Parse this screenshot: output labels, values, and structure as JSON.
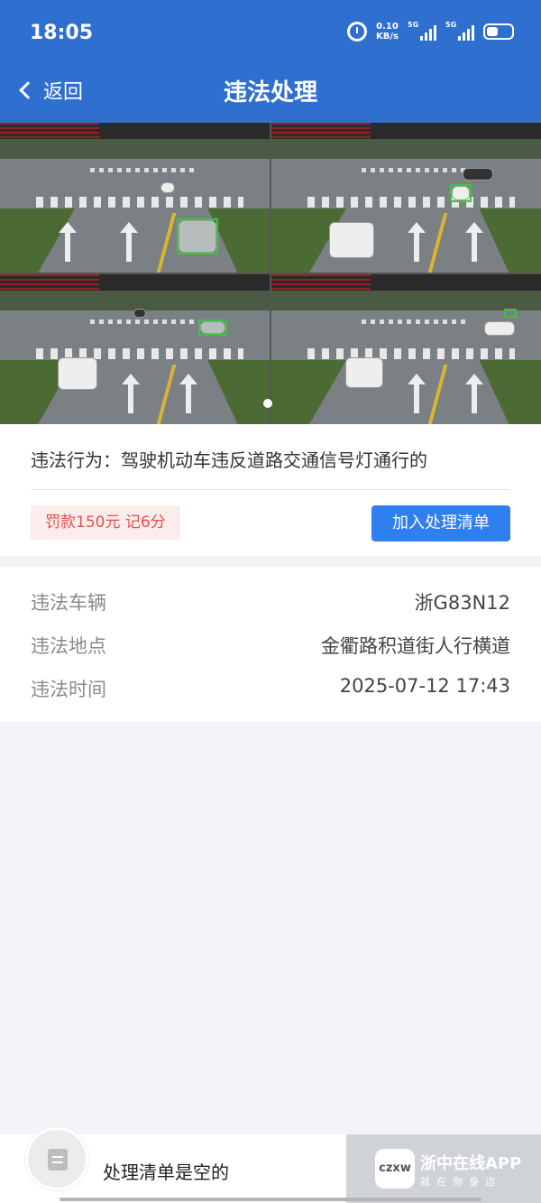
{
  "status_bar": {
    "time": "18:05",
    "speed_value": "0.10",
    "speed_unit": "KB/s",
    "sim1_tag": "5G",
    "sim2_tag": "5G"
  },
  "header": {
    "back_label": "返回",
    "title": "违法处理",
    "background": "#2f6fcf"
  },
  "photos": {
    "count": 4,
    "pager_dots": 1
  },
  "violation": {
    "behavior_label": "违法行为：",
    "behavior_text": "驾驶机动车违反道路交通信号灯通行的",
    "fine_text": "罚款150元 记6分",
    "add_button": "加入处理清单"
  },
  "details": [
    {
      "label": "违法车辆",
      "value": "浙G83N12"
    },
    {
      "label": "违法地点",
      "value": "金衢路积道街人行横道"
    },
    {
      "label": "违法时间",
      "value": "2025-07-12 17:43"
    }
  ],
  "bottom": {
    "empty_text": "处理清单是空的",
    "watermark_title": "浙中在线APP",
    "watermark_sub": "就在你身边",
    "watermark_logo": "czxw"
  },
  "colors": {
    "accent": "#2f7ff0",
    "fine_text": "#e45050",
    "fine_bg": "#fdecec"
  }
}
